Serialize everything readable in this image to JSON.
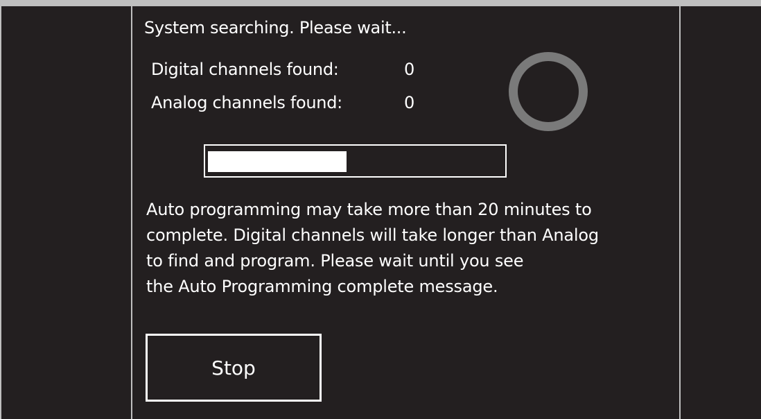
{
  "status": {
    "title": "System searching. Please wait..."
  },
  "counts": {
    "digital_label": "Digital channels found:",
    "digital_value": "0",
    "analog_label": "Analog channels found:",
    "analog_value": "0"
  },
  "progress": {
    "fraction": 0.47
  },
  "info": {
    "lines": [
      "Auto programming may take more than 20 minutes to",
      "complete. Digital channels will take longer than Analog",
      "to find and program. Please wait until you see",
      "the Auto Programming complete message."
    ]
  },
  "actions": {
    "stop_label": "Stop"
  },
  "icons": {
    "spinner": "loading-ring-icon"
  },
  "colors": {
    "background": "#231f20",
    "text": "#ffffff",
    "spinner": "#7a7a7a",
    "frame_border": "#bfbfbf"
  }
}
